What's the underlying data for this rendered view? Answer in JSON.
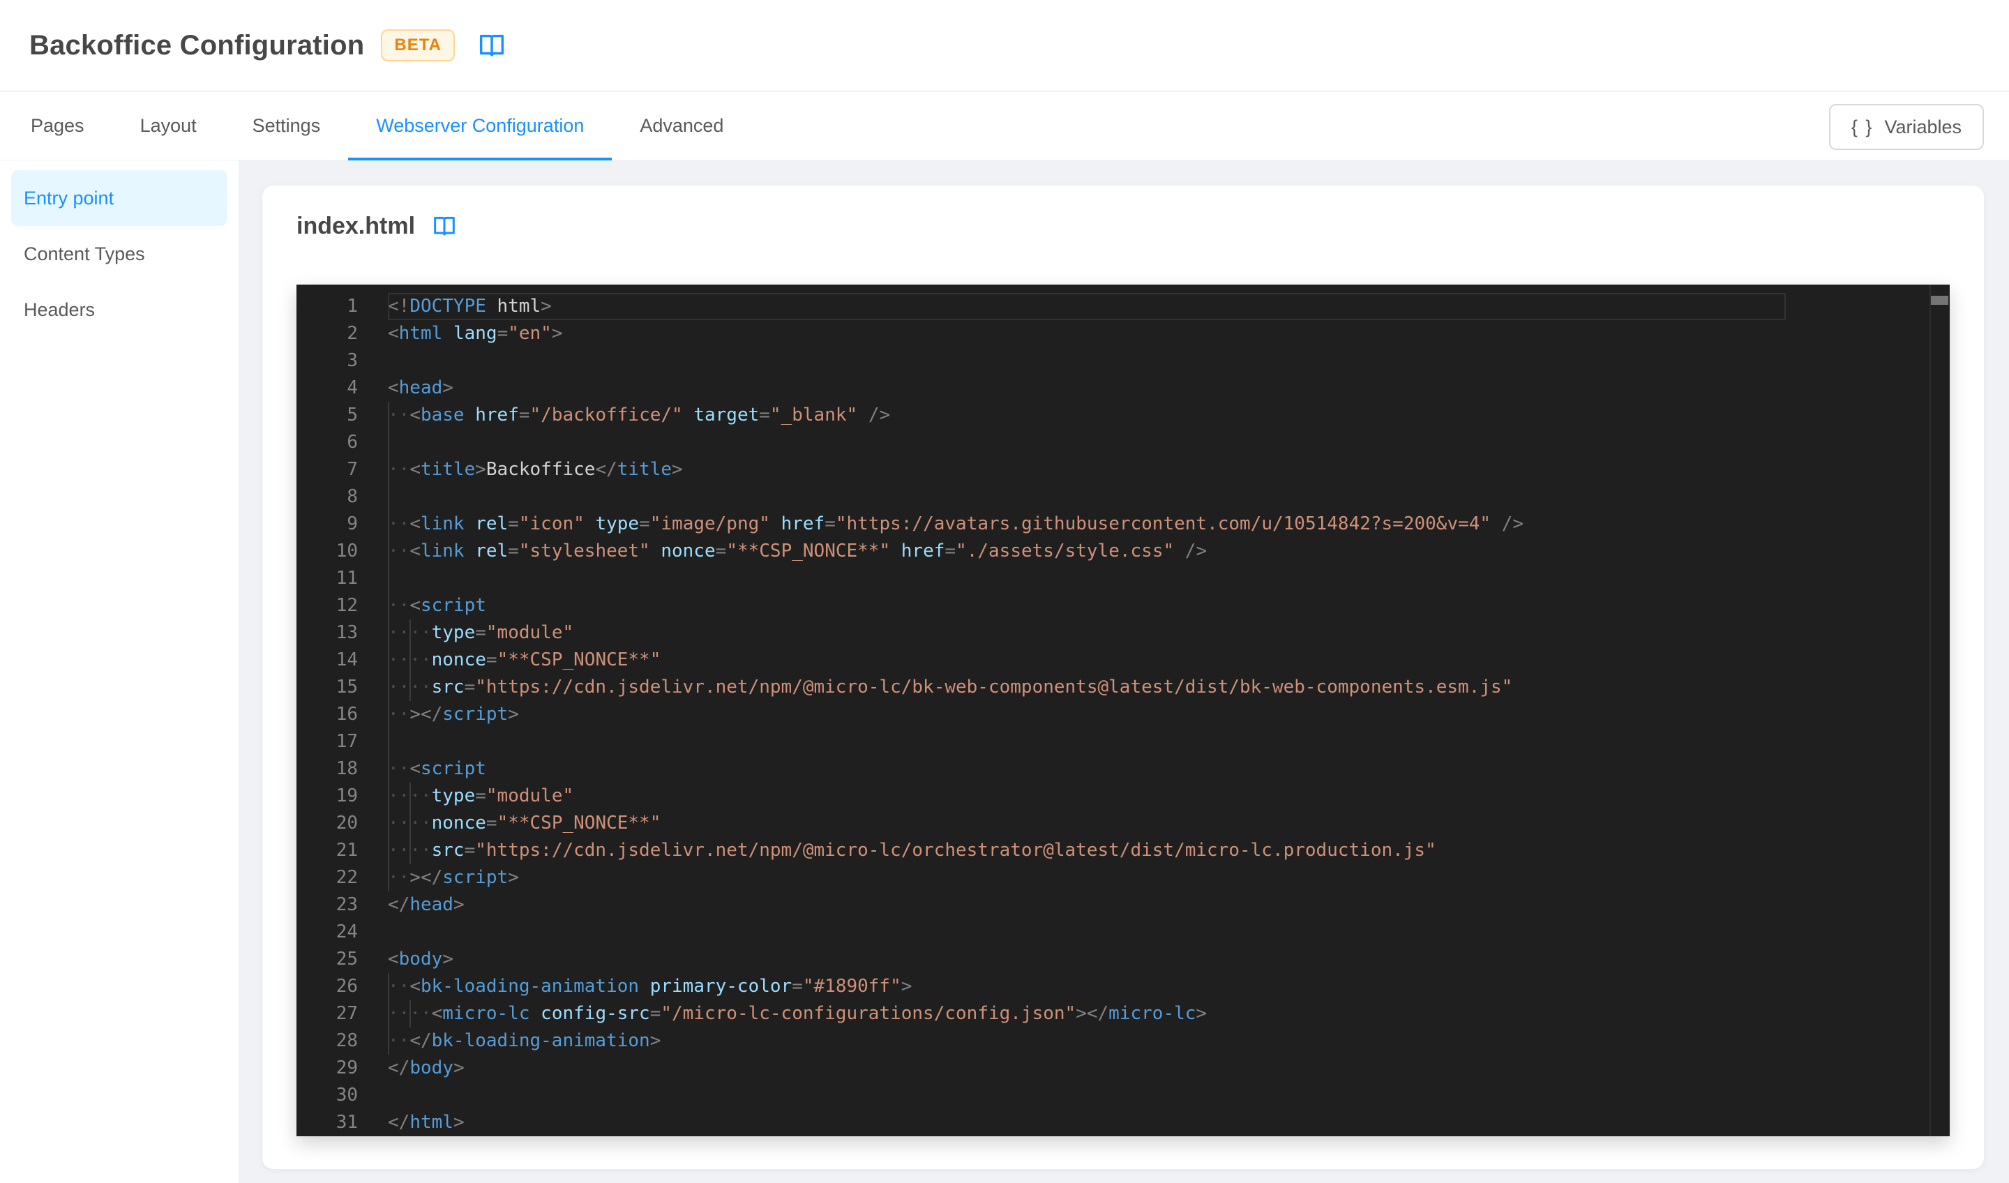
{
  "header": {
    "title": "Backoffice Configuration",
    "badge": "BETA"
  },
  "tabbar": {
    "tabs": [
      {
        "label": "Pages",
        "active": false
      },
      {
        "label": "Layout",
        "active": false
      },
      {
        "label": "Settings",
        "active": false
      },
      {
        "label": "Webserver Configuration",
        "active": true
      },
      {
        "label": "Advanced",
        "active": false
      }
    ],
    "variables_button": {
      "icon": "{ }",
      "label": "Variables"
    }
  },
  "sidebar": {
    "items": [
      {
        "label": "Entry point",
        "active": true
      },
      {
        "label": "Content Types",
        "active": false
      },
      {
        "label": "Headers",
        "active": false
      }
    ]
  },
  "main": {
    "file_title": "index.html"
  },
  "colors": {
    "accent": "#1890ff",
    "badge_text": "#e8830c",
    "badge_bg": "#fff7e6",
    "badge_border": "#ffd591",
    "active_item_bg": "#e6f7ff",
    "page_bg": "#f0f2f5",
    "editor_bg": "#1f1f1f",
    "code_tag": "#569cd6",
    "code_attr": "#9cdcfe",
    "code_string": "#ce9178",
    "code_text": "#d4d4d4",
    "code_punct": "#808080",
    "line_number": "#858585",
    "loading_primary_color": "#1890ff"
  },
  "icons": {
    "header_doc": "open-book-icon",
    "file_doc": "open-book-icon",
    "variables": "curly-braces-icon"
  },
  "editor": {
    "first_line_number": 1,
    "last_line_number": 31,
    "current_line": 1,
    "lines": [
      [
        [
          "p",
          "<!"
        ],
        [
          "t",
          "DOCTYPE"
        ],
        [
          "x",
          " html"
        ],
        [
          "p",
          ">"
        ]
      ],
      [
        [
          "p",
          "<"
        ],
        [
          "t",
          "html"
        ],
        [
          "x",
          " "
        ],
        [
          "a",
          "lang"
        ],
        [
          "p",
          "="
        ],
        [
          "s",
          "\"en\""
        ],
        [
          "p",
          ">"
        ]
      ],
      [],
      [
        [
          "p",
          "<"
        ],
        [
          "t",
          "head"
        ],
        [
          "p",
          ">"
        ]
      ],
      [
        [
          "g",
          ""
        ],
        [
          "w",
          "··"
        ],
        [
          "p",
          "<"
        ],
        [
          "t",
          "base"
        ],
        [
          "x",
          " "
        ],
        [
          "a",
          "href"
        ],
        [
          "p",
          "="
        ],
        [
          "s",
          "\"/backoffice/\""
        ],
        [
          "x",
          " "
        ],
        [
          "a",
          "target"
        ],
        [
          "p",
          "="
        ],
        [
          "s",
          "\"_blank\""
        ],
        [
          "x",
          " "
        ],
        [
          "p",
          "/>"
        ]
      ],
      [
        [
          "g",
          ""
        ]
      ],
      [
        [
          "g",
          ""
        ],
        [
          "w",
          "··"
        ],
        [
          "p",
          "<"
        ],
        [
          "t",
          "title"
        ],
        [
          "p",
          ">"
        ],
        [
          "x",
          "Backoffice"
        ],
        [
          "p",
          "</"
        ],
        [
          "t",
          "title"
        ],
        [
          "p",
          ">"
        ]
      ],
      [
        [
          "g",
          ""
        ]
      ],
      [
        [
          "g",
          ""
        ],
        [
          "w",
          "··"
        ],
        [
          "p",
          "<"
        ],
        [
          "t",
          "link"
        ],
        [
          "x",
          " "
        ],
        [
          "a",
          "rel"
        ],
        [
          "p",
          "="
        ],
        [
          "s",
          "\"icon\""
        ],
        [
          "x",
          " "
        ],
        [
          "a",
          "type"
        ],
        [
          "p",
          "="
        ],
        [
          "s",
          "\"image/png\""
        ],
        [
          "x",
          " "
        ],
        [
          "a",
          "href"
        ],
        [
          "p",
          "="
        ],
        [
          "s",
          "\"https://avatars.githubusercontent.com/u/10514842?s=200&v=4\""
        ],
        [
          "x",
          " "
        ],
        [
          "p",
          "/>"
        ]
      ],
      [
        [
          "g",
          ""
        ],
        [
          "w",
          "··"
        ],
        [
          "p",
          "<"
        ],
        [
          "t",
          "link"
        ],
        [
          "x",
          " "
        ],
        [
          "a",
          "rel"
        ],
        [
          "p",
          "="
        ],
        [
          "s",
          "\"stylesheet\""
        ],
        [
          "x",
          " "
        ],
        [
          "a",
          "nonce"
        ],
        [
          "p",
          "="
        ],
        [
          "s",
          "\"**CSP_NONCE**\""
        ],
        [
          "x",
          " "
        ],
        [
          "a",
          "href"
        ],
        [
          "p",
          "="
        ],
        [
          "s",
          "\"./assets/style.css\""
        ],
        [
          "x",
          " "
        ],
        [
          "p",
          "/>"
        ]
      ],
      [
        [
          "g",
          ""
        ]
      ],
      [
        [
          "g",
          ""
        ],
        [
          "w",
          "··"
        ],
        [
          "p",
          "<"
        ],
        [
          "t",
          "script"
        ]
      ],
      [
        [
          "g",
          ""
        ],
        [
          "w",
          "··"
        ],
        [
          "g",
          ""
        ],
        [
          "w",
          "··"
        ],
        [
          "a",
          "type"
        ],
        [
          "p",
          "="
        ],
        [
          "s",
          "\"module\""
        ]
      ],
      [
        [
          "g",
          ""
        ],
        [
          "w",
          "··"
        ],
        [
          "g",
          ""
        ],
        [
          "w",
          "··"
        ],
        [
          "a",
          "nonce"
        ],
        [
          "p",
          "="
        ],
        [
          "s",
          "\"**CSP_NONCE**\""
        ]
      ],
      [
        [
          "g",
          ""
        ],
        [
          "w",
          "··"
        ],
        [
          "g",
          ""
        ],
        [
          "w",
          "··"
        ],
        [
          "a",
          "src"
        ],
        [
          "p",
          "="
        ],
        [
          "s",
          "\"https://cdn.jsdelivr.net/npm/@micro-lc/bk-web-components@latest/dist/bk-web-components.esm.js\""
        ]
      ],
      [
        [
          "g",
          ""
        ],
        [
          "w",
          "··"
        ],
        [
          "p",
          "></"
        ],
        [
          "t",
          "script"
        ],
        [
          "p",
          ">"
        ]
      ],
      [
        [
          "g",
          ""
        ]
      ],
      [
        [
          "g",
          ""
        ],
        [
          "w",
          "··"
        ],
        [
          "p",
          "<"
        ],
        [
          "t",
          "script"
        ]
      ],
      [
        [
          "g",
          ""
        ],
        [
          "w",
          "··"
        ],
        [
          "g",
          ""
        ],
        [
          "w",
          "··"
        ],
        [
          "a",
          "type"
        ],
        [
          "p",
          "="
        ],
        [
          "s",
          "\"module\""
        ]
      ],
      [
        [
          "g",
          ""
        ],
        [
          "w",
          "··"
        ],
        [
          "g",
          ""
        ],
        [
          "w",
          "··"
        ],
        [
          "a",
          "nonce"
        ],
        [
          "p",
          "="
        ],
        [
          "s",
          "\"**CSP_NONCE**\""
        ]
      ],
      [
        [
          "g",
          ""
        ],
        [
          "w",
          "··"
        ],
        [
          "g",
          ""
        ],
        [
          "w",
          "··"
        ],
        [
          "a",
          "src"
        ],
        [
          "p",
          "="
        ],
        [
          "s",
          "\"https://cdn.jsdelivr.net/npm/@micro-lc/orchestrator@latest/dist/micro-lc.production.js\""
        ]
      ],
      [
        [
          "g",
          ""
        ],
        [
          "w",
          "··"
        ],
        [
          "p",
          "></"
        ],
        [
          "t",
          "script"
        ],
        [
          "p",
          ">"
        ]
      ],
      [
        [
          "p",
          "</"
        ],
        [
          "t",
          "head"
        ],
        [
          "p",
          ">"
        ]
      ],
      [],
      [
        [
          "p",
          "<"
        ],
        [
          "t",
          "body"
        ],
        [
          "p",
          ">"
        ]
      ],
      [
        [
          "g",
          ""
        ],
        [
          "w",
          "··"
        ],
        [
          "p",
          "<"
        ],
        [
          "t",
          "bk-loading-animation"
        ],
        [
          "x",
          " "
        ],
        [
          "a",
          "primary-color"
        ],
        [
          "p",
          "="
        ],
        [
          "s",
          "\"#1890ff\""
        ],
        [
          "p",
          ">"
        ]
      ],
      [
        [
          "g",
          ""
        ],
        [
          "w",
          "··"
        ],
        [
          "g",
          ""
        ],
        [
          "w",
          "··"
        ],
        [
          "p",
          "<"
        ],
        [
          "t",
          "micro-lc"
        ],
        [
          "x",
          " "
        ],
        [
          "a",
          "config-src"
        ],
        [
          "p",
          "="
        ],
        [
          "s",
          "\"/micro-lc-configurations/config.json\""
        ],
        [
          "p",
          "></"
        ],
        [
          "t",
          "micro-lc"
        ],
        [
          "p",
          ">"
        ]
      ],
      [
        [
          "g",
          ""
        ],
        [
          "w",
          "··"
        ],
        [
          "p",
          "</"
        ],
        [
          "t",
          "bk-loading-animation"
        ],
        [
          "p",
          ">"
        ]
      ],
      [
        [
          "p",
          "</"
        ],
        [
          "t",
          "body"
        ],
        [
          "p",
          ">"
        ]
      ],
      [],
      [
        [
          "p",
          "</"
        ],
        [
          "t",
          "html"
        ],
        [
          "p",
          ">"
        ]
      ]
    ]
  }
}
